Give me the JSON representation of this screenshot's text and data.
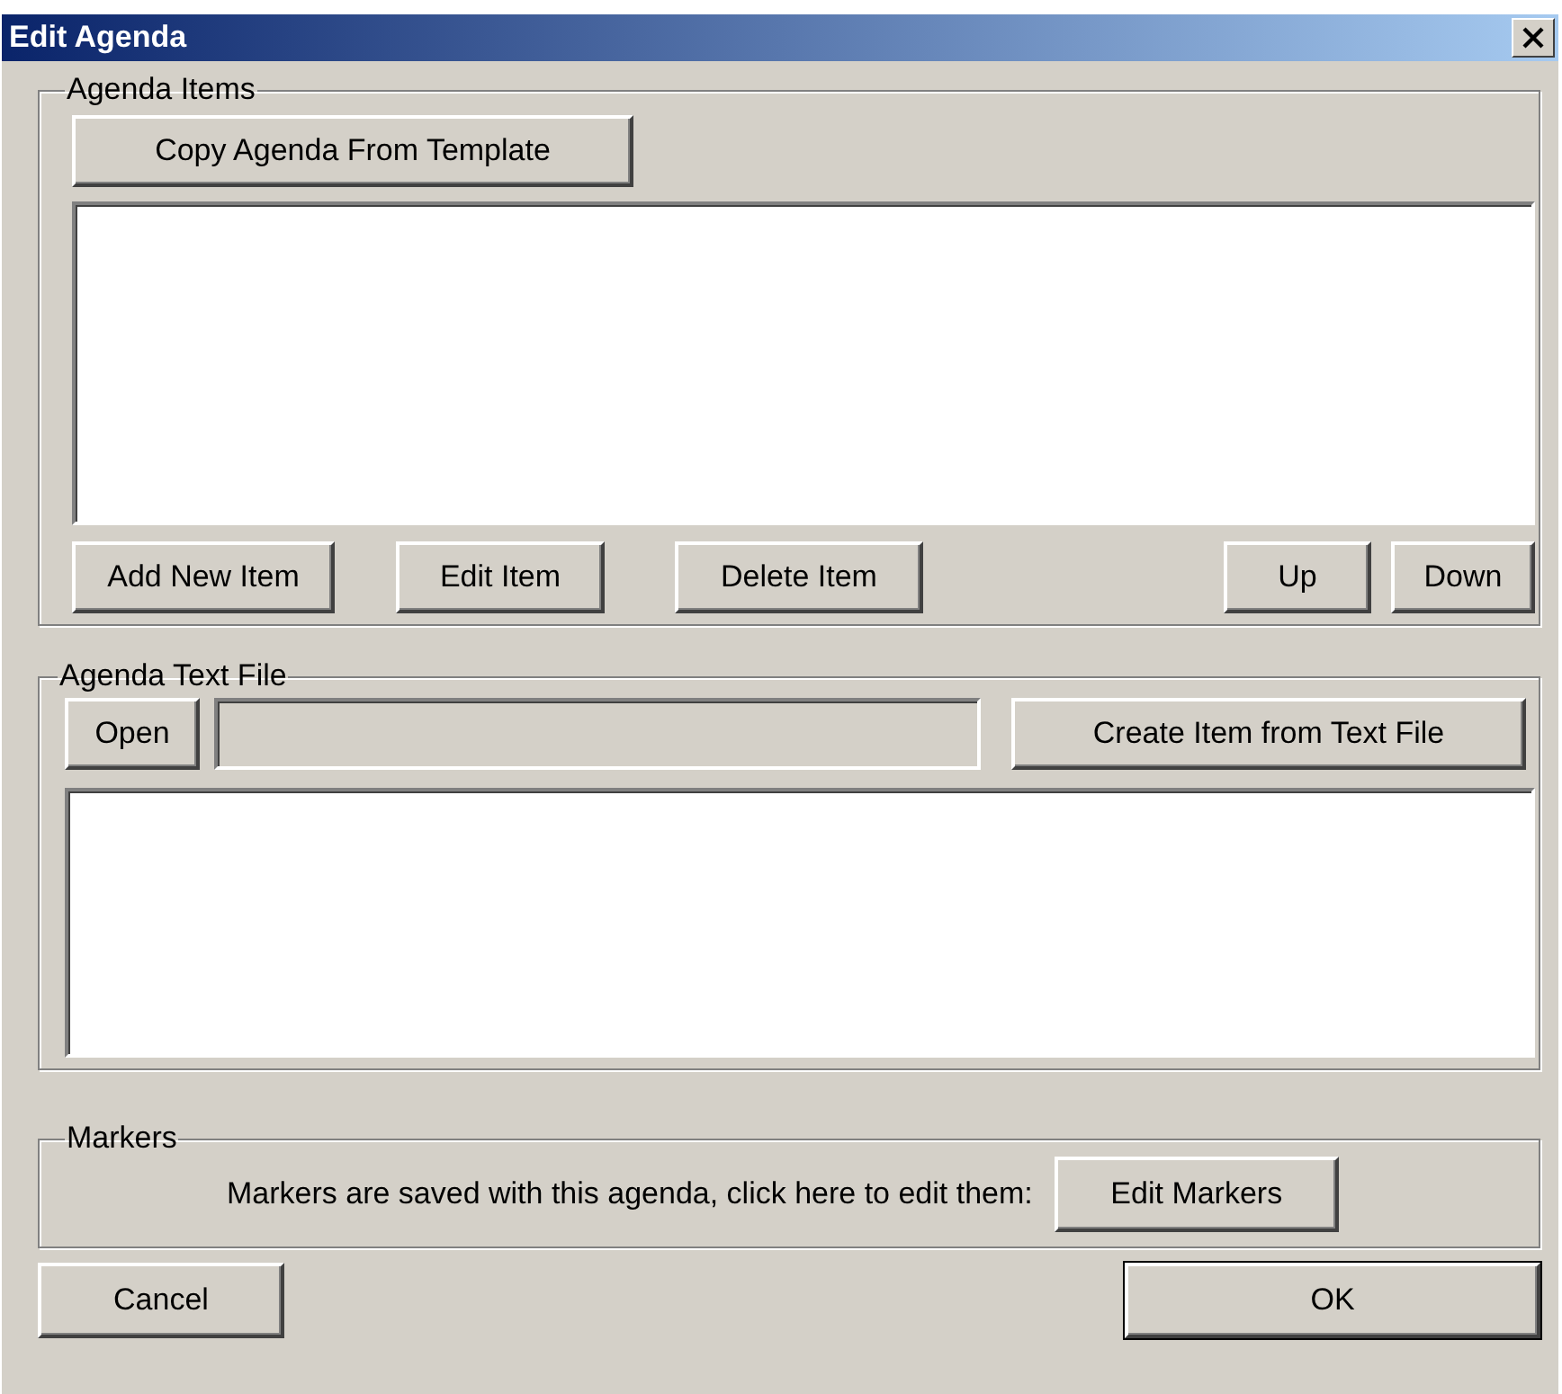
{
  "window": {
    "title": "Edit Agenda"
  },
  "agenda_items": {
    "label": "Agenda Items",
    "copy_button": "Copy Agenda From Template",
    "item_buttons": [
      "Add New Item",
      "Edit Item",
      "Delete Item"
    ],
    "order_buttons": [
      "Up",
      "Down"
    ]
  },
  "agenda_text_file": {
    "label": "Agenda Text File",
    "open_button": "Open",
    "create_button": "Create Item from Text File"
  },
  "markers": {
    "label": "Markers",
    "description": "Markers are saved with this agenda, click here to edit them:",
    "button": "Edit Markers"
  },
  "footer_buttons": [
    {
      "label": "Cancel",
      "default": false
    },
    {
      "label": "OK",
      "default": true
    }
  ]
}
